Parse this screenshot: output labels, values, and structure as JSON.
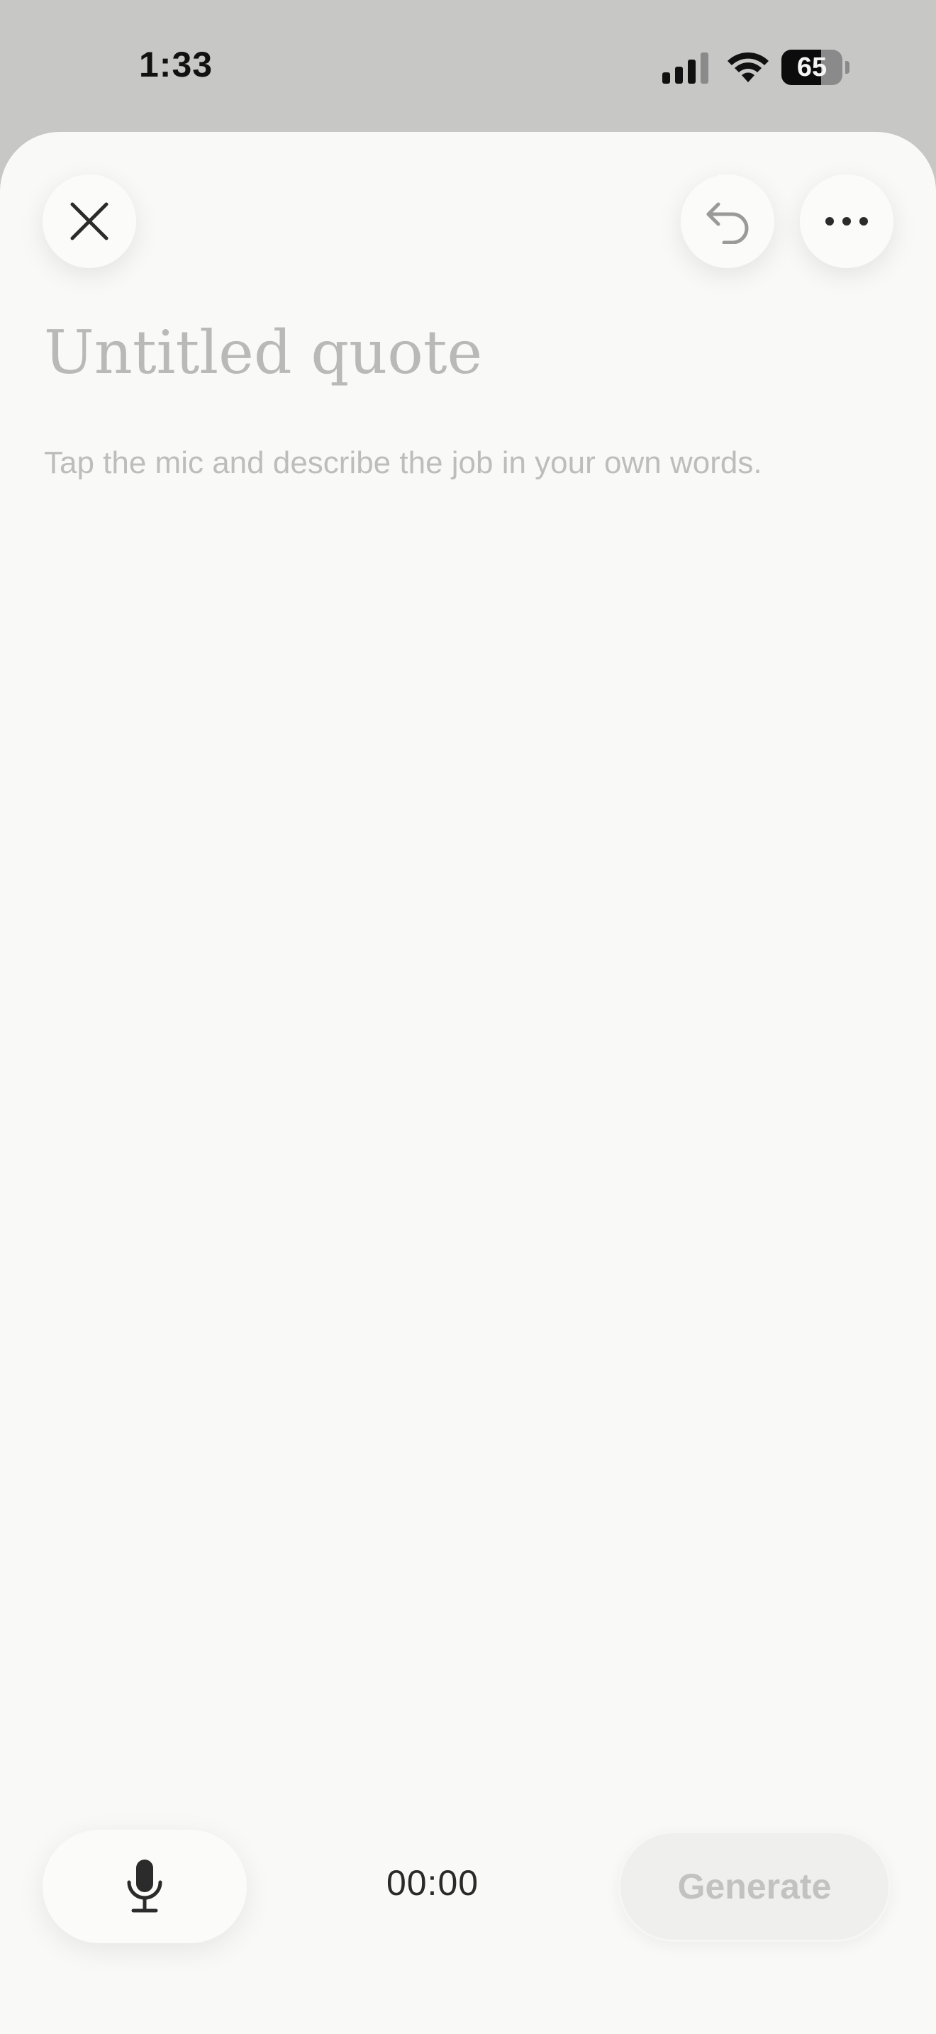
{
  "status_bar": {
    "time": "1:33",
    "battery_level": "65",
    "battery_fraction": 0.65,
    "icons": [
      "signal-icon",
      "wifi-icon",
      "battery-icon"
    ]
  },
  "editor": {
    "title_placeholder": "Untitled quote",
    "hint": "Tap the mic and describe the job in your own words."
  },
  "toolbar": {
    "icons": [
      "close-icon",
      "undo-icon",
      "more-icon"
    ]
  },
  "recorder": {
    "mic_icon": "microphone-icon",
    "timer": "00:00",
    "generate_label": "Generate"
  },
  "colors": {
    "sheet_background": "#f9f9f7",
    "status_background": "#c7c7c6",
    "icon_dark": "#2b2b2b",
    "icon_muted": "#9a9a98",
    "disabled_text": "#c2c2c0"
  }
}
